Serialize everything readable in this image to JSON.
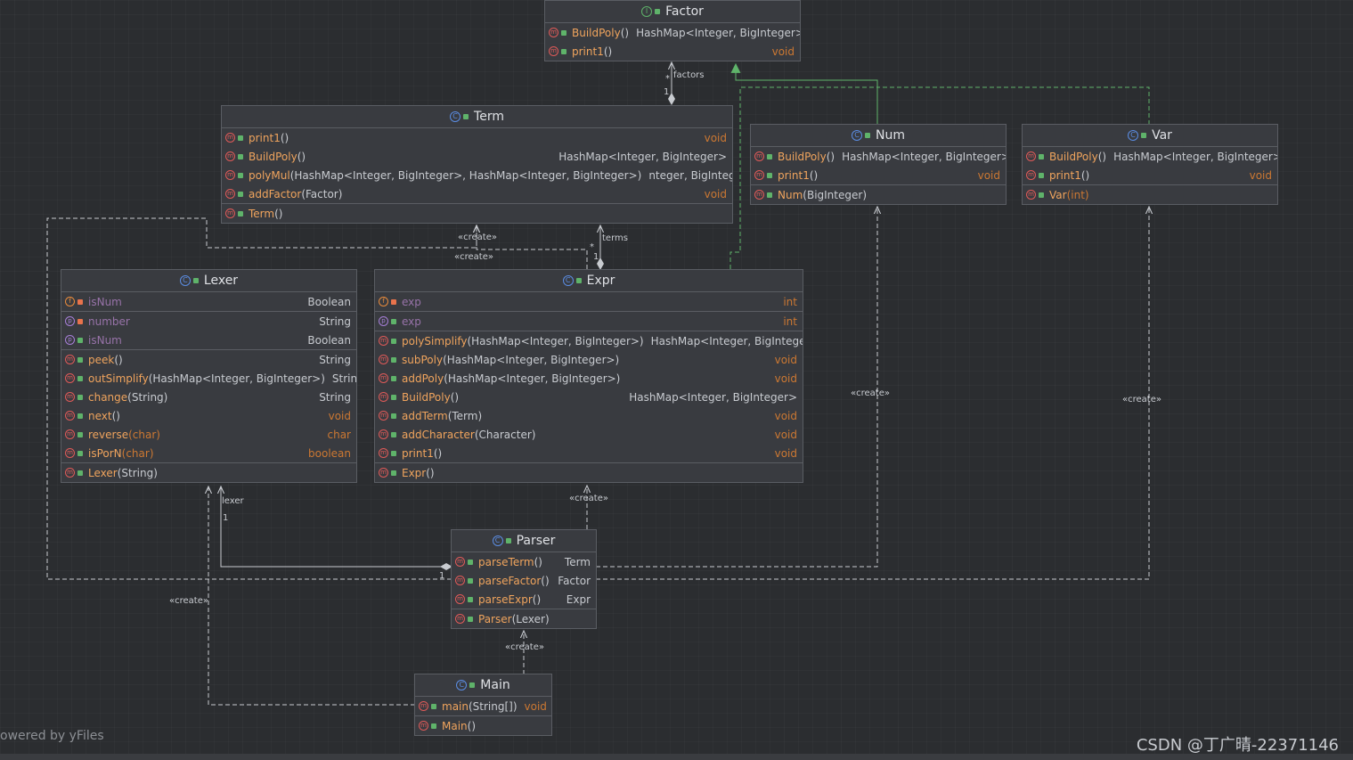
{
  "classes": {
    "factor": {
      "title": "Factor",
      "kind_glyph": "I",
      "methods": [
        {
          "name": "BuildPoly",
          "params": "()",
          "ret": "HashMap<Integer, BigInteger>"
        },
        {
          "name": "print1",
          "params": " ()",
          "ret": "void"
        }
      ]
    },
    "term": {
      "title": "Term",
      "kind_glyph": "C",
      "methods": [
        {
          "name": "print1",
          "params": " ()",
          "ret": "void"
        },
        {
          "name": "BuildPoly",
          "params": "()",
          "ret": "HashMap<Integer, BigInteger>"
        },
        {
          "name": "polyMul",
          "params": "(HashMap<Integer, BigInteger>, HashMap<Integer, BigInteger>)",
          "ret": "nteger, BigInteger>"
        },
        {
          "name": "addFactor",
          "params": "(Factor)",
          "ret": "void"
        }
      ],
      "ctor": {
        "name": "Term",
        "params": "()"
      }
    },
    "num": {
      "title": "Num",
      "kind_glyph": "C",
      "methods": [
        {
          "name": "BuildPoly",
          "params": "()",
          "ret": "HashMap<Integer, BigInteger>"
        },
        {
          "name": "print1",
          "params": " ()",
          "ret": "void"
        }
      ],
      "ctor": {
        "name": "Num",
        "params": "(BigInteger)"
      }
    },
    "var": {
      "title": "Var",
      "kind_glyph": "C",
      "methods": [
        {
          "name": "BuildPoly",
          "params": "()",
          "ret": "HashMap<Integer, BigInteger>"
        },
        {
          "name": "print1",
          "params": " ()",
          "ret": "void"
        }
      ],
      "ctor": {
        "name": "Var",
        "params": "(int)"
      }
    },
    "lexer": {
      "title": "Lexer",
      "kind_glyph": "C",
      "fields": [
        {
          "glyph": "f",
          "name": "isNum",
          "ret": "Boolean"
        },
        {
          "glyph": "p",
          "name": "number",
          "ret": "String"
        },
        {
          "glyph": "p",
          "name": "isNum",
          "ret": "Boolean"
        }
      ],
      "methods": [
        {
          "name": "peek",
          "params": "()",
          "ret": "String"
        },
        {
          "name": "outSimplify",
          "params": "(HashMap<Integer, BigInteger>)",
          "ret": "String"
        },
        {
          "name": "change",
          "params": "(String)",
          "ret": "String"
        },
        {
          "name": "next",
          "params": "()",
          "ret": "void"
        },
        {
          "name": "reverse",
          "params": "(char)",
          "ret": "char"
        },
        {
          "name": "isPorN",
          "params": "(char)",
          "ret": "boolean"
        }
      ],
      "ctor": {
        "name": "Lexer",
        "params": "(String)"
      }
    },
    "expr": {
      "title": "Expr",
      "kind_glyph": "C",
      "fields": [
        {
          "glyph": "f",
          "name": "exp",
          "ret": "int"
        },
        {
          "glyph": "p",
          "name": "exp",
          "ret": "int"
        }
      ],
      "methods": [
        {
          "name": "polySimplify",
          "params": "(HashMap<Integer, BigInteger>)",
          "ret": "HashMap<Integer, BigInteger>"
        },
        {
          "name": "subPoly",
          "params": "(HashMap<Integer, BigInteger>)",
          "ret": "void"
        },
        {
          "name": "addPoly",
          "params": "(HashMap<Integer, BigInteger>)",
          "ret": "void"
        },
        {
          "name": "BuildPoly",
          "params": "()",
          "ret": "HashMap<Integer, BigInteger>"
        },
        {
          "name": "addTerm",
          "params": "(Term)",
          "ret": "void"
        },
        {
          "name": "addCharacter",
          "params": "(Character)",
          "ret": "void"
        },
        {
          "name": "print1",
          "params": " ()",
          "ret": "void"
        }
      ],
      "ctor": {
        "name": "Expr",
        "params": "()"
      }
    },
    "parser": {
      "title": "Parser",
      "kind_glyph": "C",
      "methods": [
        {
          "name": "parseTerm",
          "params": "()",
          "ret": "Term"
        },
        {
          "name": "parseFactor",
          "params": "()",
          "ret": "Factor"
        },
        {
          "name": "parseExpr",
          "params": " ()",
          "ret": "Expr"
        }
      ],
      "ctor": {
        "name": "Parser",
        "params": "(Lexer)"
      }
    },
    "main": {
      "title": "Main",
      "kind_glyph": "C",
      "methods": [
        {
          "name": "main",
          "params": "(String[])",
          "ret": "void"
        }
      ],
      "ctor": {
        "name": "Main",
        "params": "()"
      }
    }
  },
  "edge_labels": {
    "factors": "factors",
    "terms": "terms",
    "lexer": "lexer",
    "create": "«create»",
    "mult_many": "*",
    "mult_one": "1"
  },
  "footer": {
    "yfiles": "owered by yFiles",
    "watermark": "CSDN @丁广晴-22371146"
  },
  "colors": {
    "background": "#2b2d30",
    "node_fill": "#393b40",
    "node_border": "#5a5d63",
    "method_name": "#f0a45d",
    "keyword": "#cc7832",
    "edge": "#c8cbd0",
    "realization": "#5fb36a"
  }
}
